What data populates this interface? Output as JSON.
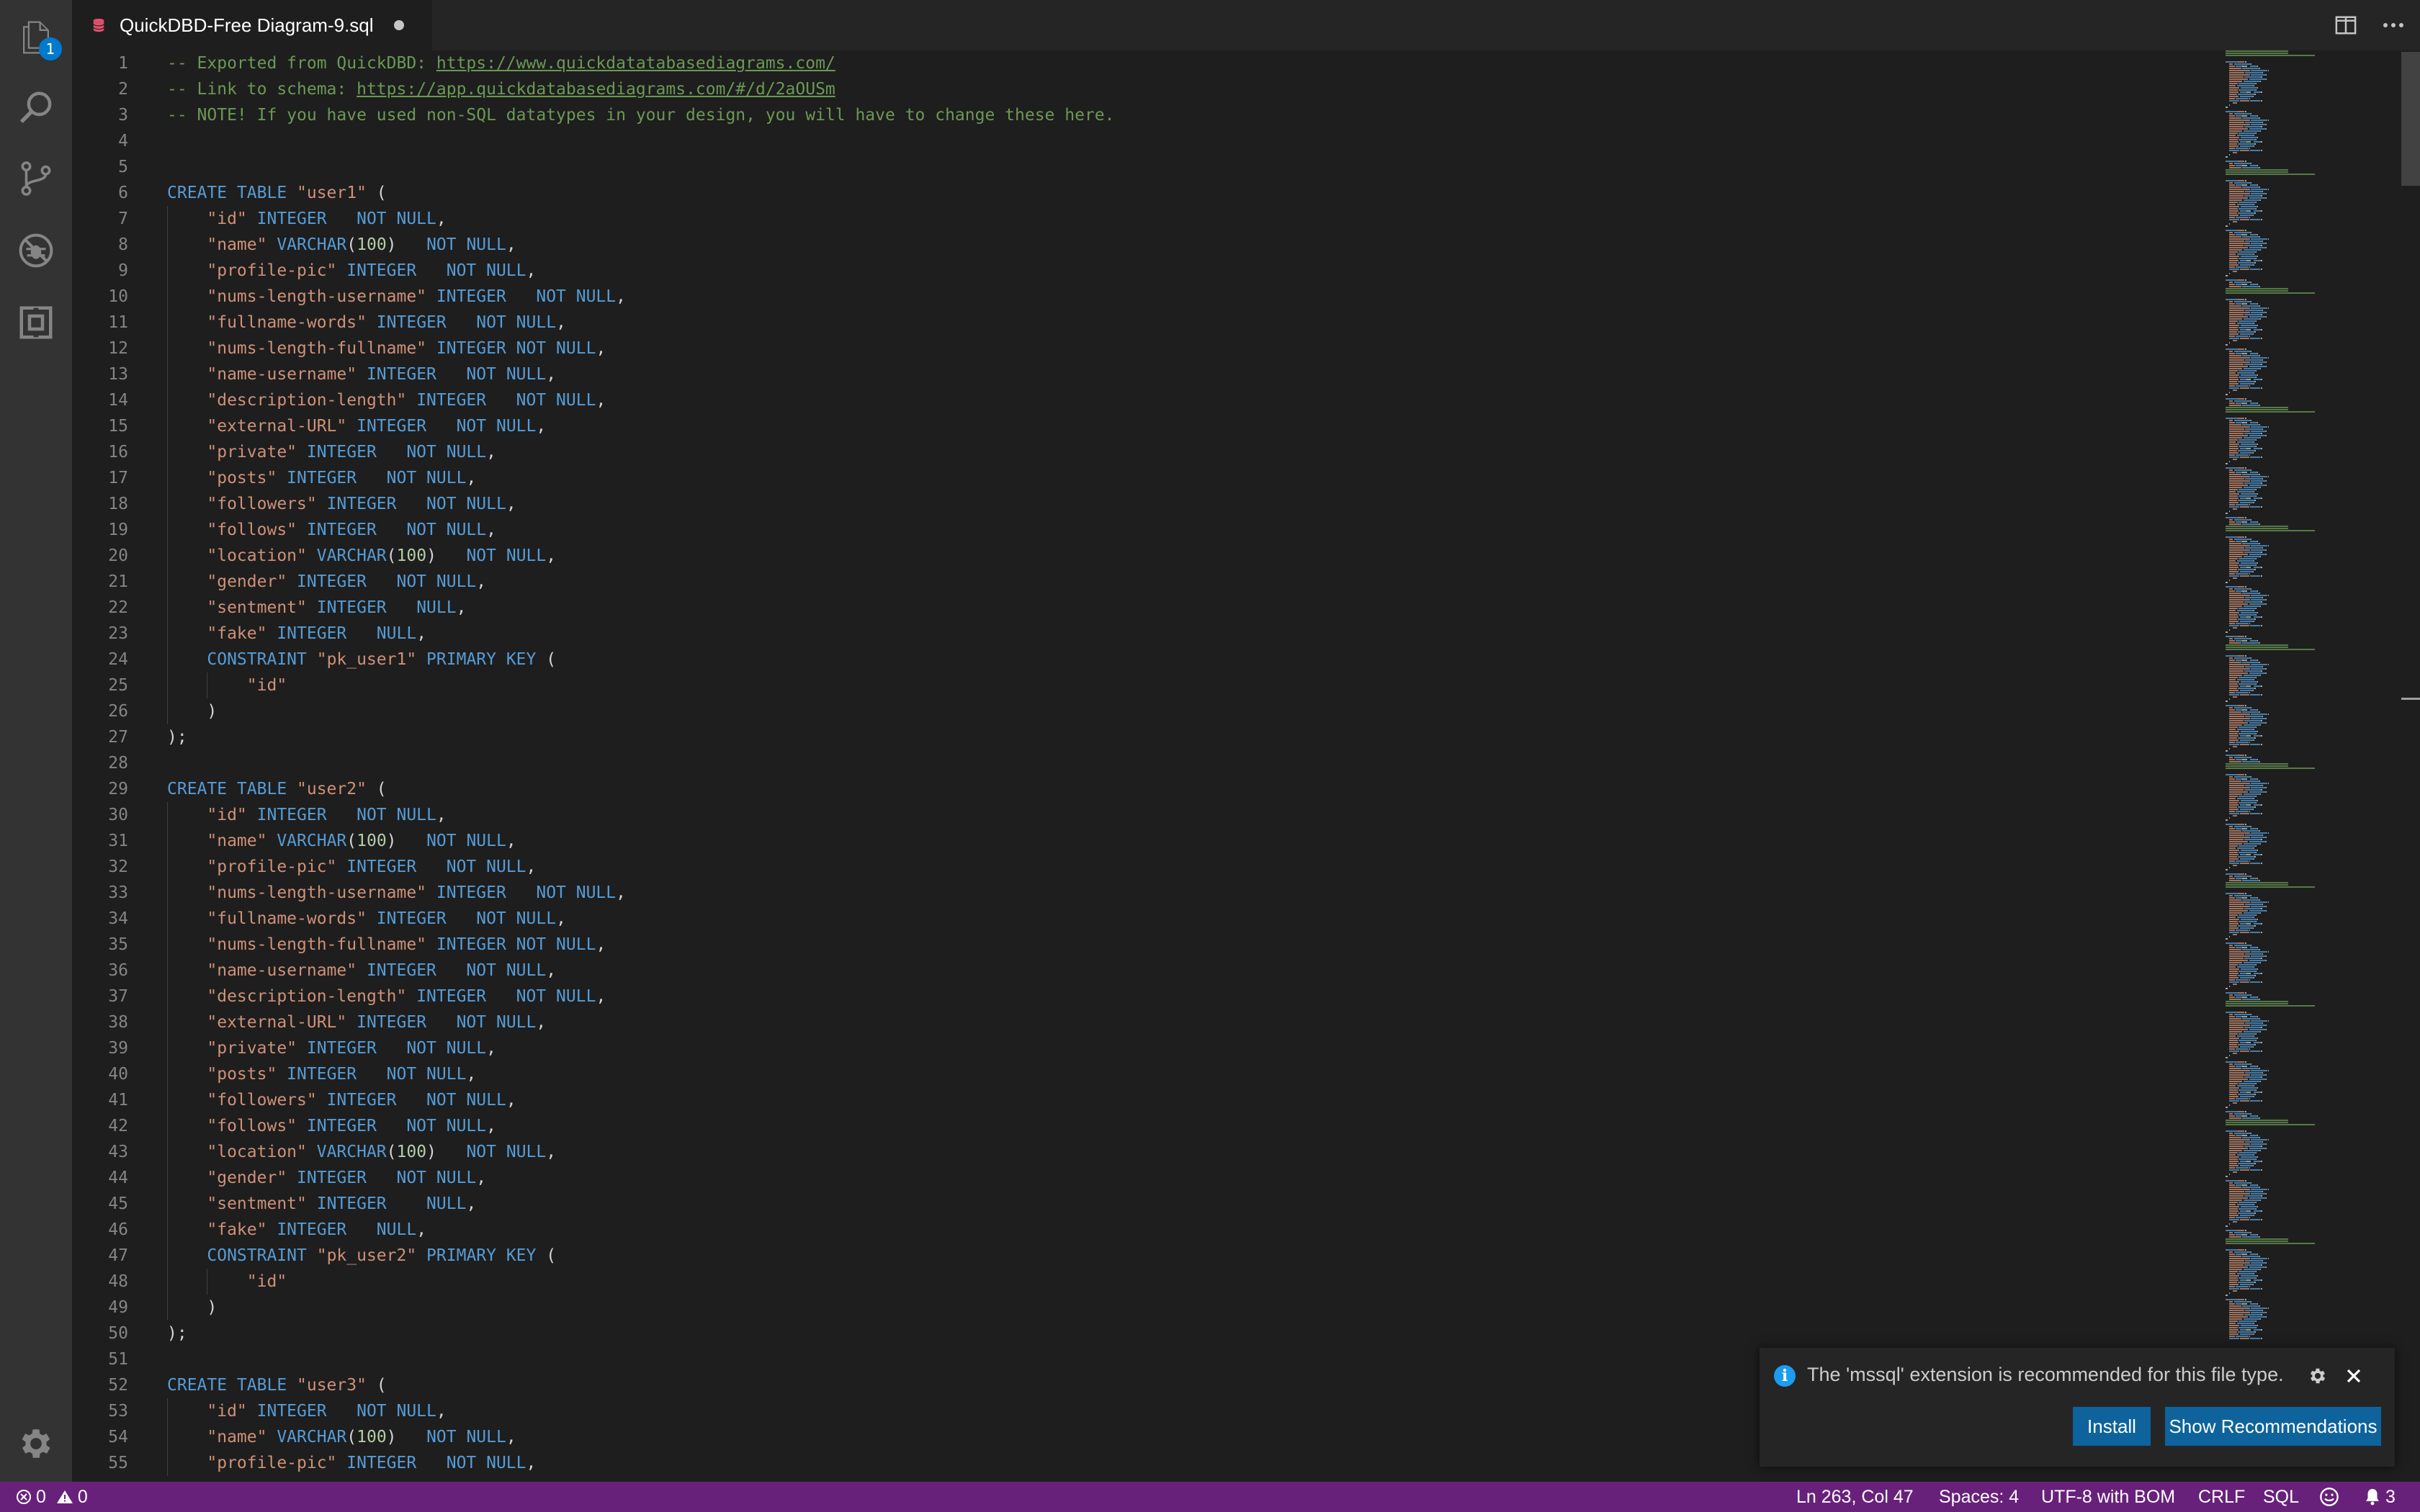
{
  "activity_bar": {
    "items": [
      {
        "name": "explorer-icon",
        "badge": "1"
      },
      {
        "name": "search-icon"
      },
      {
        "name": "source-control-icon"
      },
      {
        "name": "debug-icon"
      },
      {
        "name": "extensions-icon"
      }
    ],
    "manage": "gear-icon"
  },
  "tab": {
    "title": "QuickDBD-Free Diagram-9.sql",
    "icon": "database-file-icon",
    "dirty": true
  },
  "tab_actions": [
    "split-editor-icon",
    "more-actions-icon"
  ],
  "editor": {
    "lines": [
      [
        [
          "cm",
          "-- Exported from QuickDBD: "
        ],
        [
          "url",
          "https://www.quickdatatabasediagrams.com/"
        ]
      ],
      [
        [
          "cm",
          "-- Link to schema: "
        ],
        [
          "url",
          "https://app.quickdatabasediagrams.com/#/d/2aOUSm"
        ]
      ],
      [
        [
          "cm",
          "-- NOTE! If you have used non-SQL datatypes in your design, you will have to change these here."
        ]
      ],
      [],
      [],
      [
        [
          "kw",
          "CREATE TABLE "
        ],
        [
          "str",
          "\"user1\""
        ],
        [
          "pl",
          " ("
        ]
      ],
      [
        [
          "pl",
          "    "
        ],
        [
          "str",
          "\"id\""
        ],
        [
          "kw",
          " INTEGER   NOT NULL"
        ],
        [
          "pl",
          ","
        ]
      ],
      [
        [
          "pl",
          "    "
        ],
        [
          "str",
          "\"name\""
        ],
        [
          "kw",
          " VARCHAR"
        ],
        [
          "pl",
          "("
        ],
        [
          "num",
          "100"
        ],
        [
          "pl",
          ")"
        ],
        [
          "kw",
          "   NOT NULL"
        ],
        [
          "pl",
          ","
        ]
      ],
      [
        [
          "pl",
          "    "
        ],
        [
          "str",
          "\"profile-pic\""
        ],
        [
          "kw",
          " INTEGER   NOT NULL"
        ],
        [
          "pl",
          ","
        ]
      ],
      [
        [
          "pl",
          "    "
        ],
        [
          "str",
          "\"nums-length-username\""
        ],
        [
          "kw",
          " INTEGER   NOT NULL"
        ],
        [
          "pl",
          ","
        ]
      ],
      [
        [
          "pl",
          "    "
        ],
        [
          "str",
          "\"fullname-words\""
        ],
        [
          "kw",
          " INTEGER   NOT NULL"
        ],
        [
          "pl",
          ","
        ]
      ],
      [
        [
          "pl",
          "    "
        ],
        [
          "str",
          "\"nums-length-fullname\""
        ],
        [
          "kw",
          " INTEGER NOT NULL"
        ],
        [
          "pl",
          ","
        ]
      ],
      [
        [
          "pl",
          "    "
        ],
        [
          "str",
          "\"name-username\""
        ],
        [
          "kw",
          " INTEGER   NOT NULL"
        ],
        [
          "pl",
          ","
        ]
      ],
      [
        [
          "pl",
          "    "
        ],
        [
          "str",
          "\"description-length\""
        ],
        [
          "kw",
          " INTEGER   NOT NULL"
        ],
        [
          "pl",
          ","
        ]
      ],
      [
        [
          "pl",
          "    "
        ],
        [
          "str",
          "\"external-URL\""
        ],
        [
          "kw",
          " INTEGER   NOT NULL"
        ],
        [
          "pl",
          ","
        ]
      ],
      [
        [
          "pl",
          "    "
        ],
        [
          "str",
          "\"private\""
        ],
        [
          "kw",
          " INTEGER   NOT NULL"
        ],
        [
          "pl",
          ","
        ]
      ],
      [
        [
          "pl",
          "    "
        ],
        [
          "str",
          "\"posts\""
        ],
        [
          "kw",
          " INTEGER   NOT NULL"
        ],
        [
          "pl",
          ","
        ]
      ],
      [
        [
          "pl",
          "    "
        ],
        [
          "str",
          "\"followers\""
        ],
        [
          "kw",
          " INTEGER   NOT NULL"
        ],
        [
          "pl",
          ","
        ]
      ],
      [
        [
          "pl",
          "    "
        ],
        [
          "str",
          "\"follows\""
        ],
        [
          "kw",
          " INTEGER   NOT NULL"
        ],
        [
          "pl",
          ","
        ]
      ],
      [
        [
          "pl",
          "    "
        ],
        [
          "str",
          "\"location\""
        ],
        [
          "kw",
          " VARCHAR"
        ],
        [
          "pl",
          "("
        ],
        [
          "num",
          "100"
        ],
        [
          "pl",
          ")"
        ],
        [
          "kw",
          "   NOT NULL"
        ],
        [
          "pl",
          ","
        ]
      ],
      [
        [
          "pl",
          "    "
        ],
        [
          "str",
          "\"gender\""
        ],
        [
          "kw",
          " INTEGER   NOT NULL"
        ],
        [
          "pl",
          ","
        ]
      ],
      [
        [
          "pl",
          "    "
        ],
        [
          "str",
          "\"sentment\""
        ],
        [
          "kw",
          " INTEGER   NULL"
        ],
        [
          "pl",
          ","
        ]
      ],
      [
        [
          "pl",
          "    "
        ],
        [
          "str",
          "\"fake\""
        ],
        [
          "kw",
          " INTEGER   NULL"
        ],
        [
          "pl",
          ","
        ]
      ],
      [
        [
          "pl",
          "    "
        ],
        [
          "kw",
          "CONSTRAINT "
        ],
        [
          "str",
          "\"pk_user1\""
        ],
        [
          "kw",
          " PRIMARY KEY"
        ],
        [
          "pl",
          " ("
        ]
      ],
      [
        [
          "pl",
          "        "
        ],
        [
          "str",
          "\"id\""
        ]
      ],
      [
        [
          "pl",
          "    )"
        ]
      ],
      [
        [
          "pl",
          ");"
        ]
      ],
      [],
      [
        [
          "kw",
          "CREATE TABLE "
        ],
        [
          "str",
          "\"user2\""
        ],
        [
          "pl",
          " ("
        ]
      ],
      [
        [
          "pl",
          "    "
        ],
        [
          "str",
          "\"id\""
        ],
        [
          "kw",
          " INTEGER   NOT NULL"
        ],
        [
          "pl",
          ","
        ]
      ],
      [
        [
          "pl",
          "    "
        ],
        [
          "str",
          "\"name\""
        ],
        [
          "kw",
          " VARCHAR"
        ],
        [
          "pl",
          "("
        ],
        [
          "num",
          "100"
        ],
        [
          "pl",
          ")"
        ],
        [
          "kw",
          "   NOT NULL"
        ],
        [
          "pl",
          ","
        ]
      ],
      [
        [
          "pl",
          "    "
        ],
        [
          "str",
          "\"profile-pic\""
        ],
        [
          "kw",
          " INTEGER   NOT NULL"
        ],
        [
          "pl",
          ","
        ]
      ],
      [
        [
          "pl",
          "    "
        ],
        [
          "str",
          "\"nums-length-username\""
        ],
        [
          "kw",
          " INTEGER   NOT NULL"
        ],
        [
          "pl",
          ","
        ]
      ],
      [
        [
          "pl",
          "    "
        ],
        [
          "str",
          "\"fullname-words\""
        ],
        [
          "kw",
          " INTEGER   NOT NULL"
        ],
        [
          "pl",
          ","
        ]
      ],
      [
        [
          "pl",
          "    "
        ],
        [
          "str",
          "\"nums-length-fullname\""
        ],
        [
          "kw",
          " INTEGER NOT NULL"
        ],
        [
          "pl",
          ","
        ]
      ],
      [
        [
          "pl",
          "    "
        ],
        [
          "str",
          "\"name-username\""
        ],
        [
          "kw",
          " INTEGER   NOT NULL"
        ],
        [
          "pl",
          ","
        ]
      ],
      [
        [
          "pl",
          "    "
        ],
        [
          "str",
          "\"description-length\""
        ],
        [
          "kw",
          " INTEGER   NOT NULL"
        ],
        [
          "pl",
          ","
        ]
      ],
      [
        [
          "pl",
          "    "
        ],
        [
          "str",
          "\"external-URL\""
        ],
        [
          "kw",
          " INTEGER   NOT NULL"
        ],
        [
          "pl",
          ","
        ]
      ],
      [
        [
          "pl",
          "    "
        ],
        [
          "str",
          "\"private\""
        ],
        [
          "kw",
          " INTEGER   NOT NULL"
        ],
        [
          "pl",
          ","
        ]
      ],
      [
        [
          "pl",
          "    "
        ],
        [
          "str",
          "\"posts\""
        ],
        [
          "kw",
          " INTEGER   NOT NULL"
        ],
        [
          "pl",
          ","
        ]
      ],
      [
        [
          "pl",
          "    "
        ],
        [
          "str",
          "\"followers\""
        ],
        [
          "kw",
          " INTEGER   NOT NULL"
        ],
        [
          "pl",
          ","
        ]
      ],
      [
        [
          "pl",
          "    "
        ],
        [
          "str",
          "\"follows\""
        ],
        [
          "kw",
          " INTEGER   NOT NULL"
        ],
        [
          "pl",
          ","
        ]
      ],
      [
        [
          "pl",
          "    "
        ],
        [
          "str",
          "\"location\""
        ],
        [
          "kw",
          " VARCHAR"
        ],
        [
          "pl",
          "("
        ],
        [
          "num",
          "100"
        ],
        [
          "pl",
          ")"
        ],
        [
          "kw",
          "   NOT NULL"
        ],
        [
          "pl",
          ","
        ]
      ],
      [
        [
          "pl",
          "    "
        ],
        [
          "str",
          "\"gender\""
        ],
        [
          "kw",
          " INTEGER   NOT NULL"
        ],
        [
          "pl",
          ","
        ]
      ],
      [
        [
          "pl",
          "    "
        ],
        [
          "str",
          "\"sentment\""
        ],
        [
          "kw",
          " INTEGER    NULL"
        ],
        [
          "pl",
          ","
        ]
      ],
      [
        [
          "pl",
          "    "
        ],
        [
          "str",
          "\"fake\""
        ],
        [
          "kw",
          " INTEGER   NULL"
        ],
        [
          "pl",
          ","
        ]
      ],
      [
        [
          "pl",
          "    "
        ],
        [
          "kw",
          "CONSTRAINT "
        ],
        [
          "str",
          "\"pk_user2\""
        ],
        [
          "kw",
          " PRIMARY KEY"
        ],
        [
          "pl",
          " ("
        ]
      ],
      [
        [
          "pl",
          "        "
        ],
        [
          "str",
          "\"id\""
        ]
      ],
      [
        [
          "pl",
          "    )"
        ]
      ],
      [
        [
          "pl",
          ");"
        ]
      ],
      [],
      [
        [
          "kw",
          "CREATE TABLE "
        ],
        [
          "str",
          "\"user3\""
        ],
        [
          "pl",
          " ("
        ]
      ],
      [
        [
          "pl",
          "    "
        ],
        [
          "str",
          "\"id\""
        ],
        [
          "kw",
          " INTEGER   NOT NULL"
        ],
        [
          "pl",
          ","
        ]
      ],
      [
        [
          "pl",
          "    "
        ],
        [
          "str",
          "\"name\""
        ],
        [
          "kw",
          " VARCHAR"
        ],
        [
          "pl",
          "("
        ],
        [
          "num",
          "100"
        ],
        [
          "pl",
          ")"
        ],
        [
          "kw",
          "   NOT NULL"
        ],
        [
          "pl",
          ","
        ]
      ],
      [
        [
          "pl",
          "    "
        ],
        [
          "str",
          "\"profile-pic\""
        ],
        [
          "kw",
          " INTEGER   NOT NULL"
        ],
        [
          "pl",
          ","
        ]
      ]
    ]
  },
  "notification": {
    "icon": "info-icon",
    "message": "The 'mssql' extension is recommended for this file type.",
    "install_label": "Install",
    "recommendations_label": "Show Recommendations"
  },
  "status_bar": {
    "errors": "0",
    "warnings": "0",
    "cursor": "Ln 263, Col 47",
    "spaces": "Spaces: 4",
    "encoding": "UTF-8 with BOM",
    "eol": "CRLF",
    "language": "SQL",
    "notifications": "3"
  },
  "colors": {
    "activity_bar": "#333333",
    "editor_bg": "#1e1e1e",
    "status_bar": "#68217a",
    "button": "#0e639c",
    "comment": "#6a9955",
    "keyword": "#569cd6",
    "string": "#ce9178",
    "number": "#b5cea8"
  }
}
